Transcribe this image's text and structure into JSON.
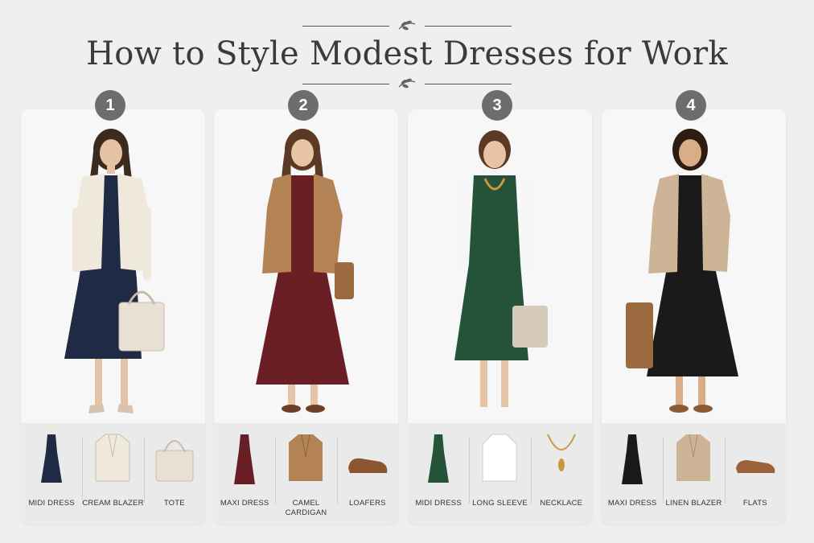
{
  "title": "How to Style Modest Dresses for Work",
  "outfits": [
    {
      "number": "1",
      "dress_color": "#1f2a44",
      "items": [
        {
          "label": "MIDI DRESS",
          "icon": "midi-dress-icon"
        },
        {
          "label": "CREAM BLAZER",
          "icon": "blazer-icon"
        },
        {
          "label": "TOTE",
          "icon": "tote-icon"
        }
      ]
    },
    {
      "number": "2",
      "dress_color": "#6a1f24",
      "items": [
        {
          "label": "MAXI DRESS",
          "icon": "maxi-dress-icon"
        },
        {
          "label": "CAMEL CARDIGAN",
          "icon": "cardigan-icon"
        },
        {
          "label": "LOAFERS",
          "icon": "loafer-icon"
        }
      ]
    },
    {
      "number": "3",
      "dress_color": "#24533a",
      "items": [
        {
          "label": "MIDI DRESS",
          "icon": "midi-dress-icon"
        },
        {
          "label": "LONG SLEEVE",
          "icon": "long-sleeve-icon"
        },
        {
          "label": "NECKLACE",
          "icon": "necklace-icon"
        }
      ]
    },
    {
      "number": "4",
      "dress_color": "#1a1a1a",
      "items": [
        {
          "label": "MAXI DRESS",
          "icon": "maxi-dress-icon"
        },
        {
          "label": "LINEN BLAZER",
          "icon": "blazer-icon"
        },
        {
          "label": "FLATS",
          "icon": "flats-icon"
        }
      ]
    }
  ]
}
